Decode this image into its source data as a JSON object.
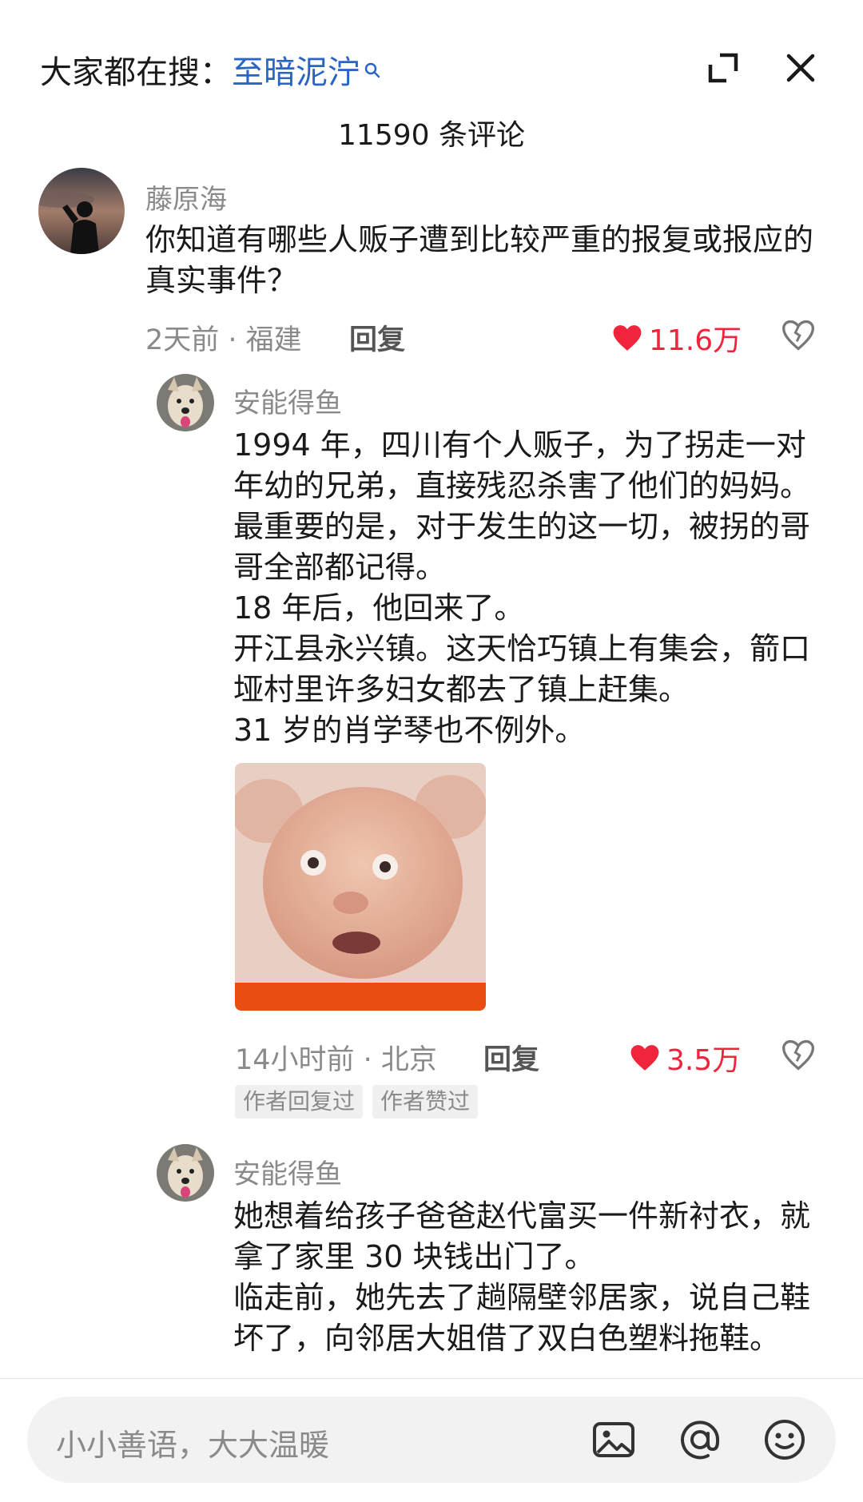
{
  "header": {
    "search_prefix": "大家都在搜：",
    "search_term": "至暗泥泞",
    "comment_count": "11590 条评论"
  },
  "main_comment": {
    "author": "藤原海",
    "text": "你知道有哪些人贩子遭到比较严重的报复或报应的\n真实事件？",
    "meta": "2天前 · 福建",
    "reply_label": "回复",
    "likes": "11.6万"
  },
  "reply1": {
    "author": "安能得鱼",
    "text": "1994 年，四川有个人贩子，为了拐走一对\n年幼的兄弟，直接残忍杀害了他们的妈妈。\n最重要的是，对于发生的这一切，被拐的哥\n哥全部都记得。\n18 年后，他回来了。\n开江县永兴镇。这天恰巧镇上有集会，箭口\n垭村里许多妇女都去了镇上赶集。\n31 岁的肖学琴也不例外。",
    "meta": "14小时前 · 北京",
    "reply_label": "回复",
    "likes": "3.5万",
    "tags": [
      "作者回复过",
      "作者赞过"
    ]
  },
  "reply2": {
    "author": "安能得鱼",
    "text": "她想着给孩子爸爸赵代富买一件新衬衣，就\n拿了家里 30 块钱出门了。\n临走前，她先去了趟隔壁邻居家，说自己鞋\n坏了，向邻居大姐借了双白色塑料拖鞋。"
  },
  "input": {
    "placeholder": "小小善语，大大温暖"
  },
  "colors": {
    "accent_blue": "#2a64c4",
    "like_red": "#f0243c",
    "meta_gray": "#8a8a8a"
  },
  "icons": [
    "search-icon",
    "expand-icon",
    "close-icon",
    "heart-icon",
    "dislike-heart-icon",
    "image-icon",
    "at-icon",
    "emoji-icon"
  ]
}
